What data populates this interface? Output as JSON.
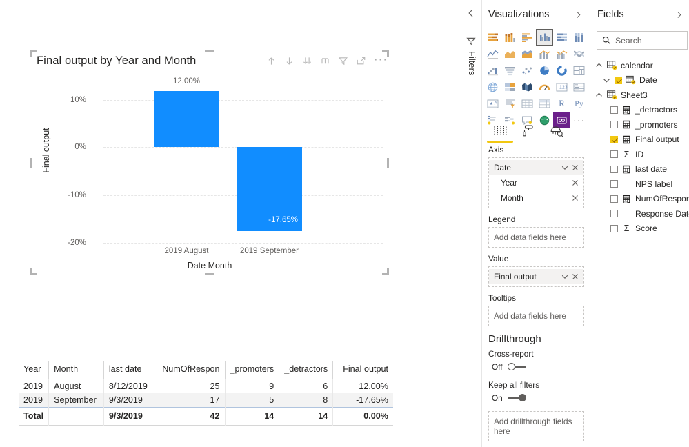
{
  "chart_data": {
    "type": "bar",
    "title": "Final output by Year and Month",
    "xlabel": "Date Month",
    "ylabel": "Final output",
    "categories": [
      "2019 August",
      "2019 September"
    ],
    "values": [
      12.0,
      -17.65
    ],
    "data_labels": [
      "12.00%",
      "-17.65%"
    ],
    "ytick_labels": [
      "10%",
      "0%",
      "-10%",
      "-20%"
    ],
    "ytick_values": [
      10,
      0,
      -10,
      -20
    ],
    "ylim": [
      -22,
      13
    ],
    "grid": true,
    "legend": "none",
    "series_color": "#118DFF"
  },
  "chart_visual": {
    "title": "Final output by Year and Month",
    "header_icons": [
      {
        "name": "drill-up-icon",
        "label": "Drill up"
      },
      {
        "name": "drill-down-icon",
        "label": "Go to the next level in the hierarchy"
      },
      {
        "name": "expand-all-icon",
        "label": "Expand all down one level in the hierarchy"
      },
      {
        "name": "drill-mode-icon",
        "label": "Drill mode"
      },
      {
        "name": "filter-icon",
        "label": "Filters"
      },
      {
        "name": "focus-mode-icon",
        "label": "Focus mode"
      },
      {
        "name": "more-options-icon",
        "label": "More options"
      }
    ]
  },
  "table_visual": {
    "columns": [
      "Year",
      "Month",
      "last date",
      "NumOfRespon",
      "_promoters",
      "_detractors",
      "Final output"
    ],
    "column_align": [
      "right",
      "left",
      "left",
      "right",
      "right",
      "right",
      "right"
    ],
    "rows": [
      [
        "2019",
        "August",
        "8/12/2019",
        "25",
        "9",
        "6",
        "12.00%"
      ],
      [
        "2019",
        "September",
        "9/3/2019",
        "17",
        "5",
        "8",
        "-17.65%"
      ]
    ],
    "total_row": [
      "Total",
      "",
      "9/3/2019",
      "42",
      "14",
      "14",
      "0.00%"
    ]
  },
  "filters_rail": {
    "label": "Filters",
    "collapse_icon": "chevron-left-icon",
    "filter_icon": "filter-icon"
  },
  "visualizations": {
    "title": "Visualizations",
    "expand_icon": "chevron-right-icon",
    "gallery": [
      {
        "name": "stacked-bar-chart",
        "selected": false
      },
      {
        "name": "stacked-column-chart",
        "selected": false
      },
      {
        "name": "clustered-bar-chart",
        "selected": false
      },
      {
        "name": "clustered-column-chart",
        "selected": true
      },
      {
        "name": "100-percent-stacked-bar-chart",
        "selected": false
      },
      {
        "name": "100-percent-stacked-column-chart",
        "selected": false
      },
      {
        "name": "line-chart",
        "selected": false
      },
      {
        "name": "area-chart",
        "selected": false
      },
      {
        "name": "stacked-area-chart",
        "selected": false
      },
      {
        "name": "line-and-stacked-column-chart",
        "selected": false
      },
      {
        "name": "line-and-clustered-column-chart",
        "selected": false
      },
      {
        "name": "ribbon-chart",
        "selected": false
      },
      {
        "name": "waterfall-chart",
        "selected": false
      },
      {
        "name": "funnel-chart",
        "selected": false
      },
      {
        "name": "scatter-chart",
        "selected": false
      },
      {
        "name": "pie-chart",
        "selected": false
      },
      {
        "name": "donut-chart",
        "selected": false
      },
      {
        "name": "treemap",
        "selected": false
      },
      {
        "name": "map",
        "selected": false
      },
      {
        "name": "filled-map",
        "selected": false
      },
      {
        "name": "shape-map",
        "selected": false
      },
      {
        "name": "gauge",
        "selected": false
      },
      {
        "name": "card",
        "selected": false
      },
      {
        "name": "multi-row-card",
        "selected": false
      },
      {
        "name": "kpi",
        "selected": false
      },
      {
        "name": "slicer",
        "selected": false
      },
      {
        "name": "table",
        "selected": false
      },
      {
        "name": "matrix",
        "selected": false
      },
      {
        "name": "r-script-visual",
        "selected": false,
        "text": "R"
      },
      {
        "name": "python-visual",
        "selected": false,
        "text": "Py"
      },
      {
        "name": "key-influencers",
        "selected": false
      },
      {
        "name": "decomposition-tree",
        "selected": false
      },
      {
        "name": "q-and-a",
        "selected": false
      },
      {
        "name": "arcgis-maps",
        "selected": false
      },
      {
        "name": "paginated-report",
        "selected": false,
        "purple": true
      },
      {
        "name": "more-visuals",
        "selected": false,
        "text": "..."
      }
    ],
    "tabs": [
      {
        "name": "fields-tab",
        "label": "Fields",
        "icon": "fields-grid-icon",
        "active": true
      },
      {
        "name": "format-tab",
        "label": "Format",
        "icon": "paint-roller-icon",
        "active": false
      },
      {
        "name": "analytics-tab",
        "label": "Analytics",
        "icon": "analytics-magnifier-icon",
        "active": false
      }
    ],
    "wells": {
      "axis": {
        "label": "Axis",
        "chips": [
          {
            "name": "Date",
            "sub": false,
            "has_chevron": true
          },
          {
            "name": "Year",
            "sub": true,
            "has_chevron": false
          },
          {
            "name": "Month",
            "sub": true,
            "has_chevron": false
          }
        ]
      },
      "legend": {
        "label": "Legend",
        "placeholder": "Add data fields here",
        "chips": []
      },
      "value": {
        "label": "Value",
        "chips": [
          {
            "name": "Final output",
            "sub": false,
            "has_chevron": true
          }
        ]
      },
      "tooltips": {
        "label": "Tooltips",
        "placeholder": "Add data fields here",
        "chips": []
      }
    },
    "drillthrough": {
      "title": "Drillthrough",
      "cross_report": {
        "label": "Cross-report",
        "state": "Off",
        "on": false
      },
      "keep_all_filters": {
        "label": "Keep all filters",
        "state": "On",
        "on": true
      },
      "placeholder": "Add drillthrough fields here"
    }
  },
  "fields": {
    "title": "Fields",
    "expand_icon": "chevron-right-icon",
    "search": {
      "placeholder": "Search",
      "value": "",
      "icon": "search-icon"
    },
    "tree": [
      {
        "label": "calendar",
        "type": "table",
        "indent": 0,
        "expanded": true,
        "checkbox": false,
        "icon": "table-icon"
      },
      {
        "label": "Date",
        "type": "hierarchy",
        "indent": 1,
        "expanded": true,
        "checkbox": true,
        "checked": true,
        "icon": "date-hierarchy-icon"
      },
      {
        "label": "Sheet3",
        "type": "table",
        "indent": 0,
        "expanded": true,
        "checkbox": false,
        "icon": "table-icon"
      },
      {
        "label": "_detractors",
        "type": "measure",
        "indent": 2,
        "checkbox": true,
        "checked": false,
        "icon": "measure-icon"
      },
      {
        "label": "_promoters",
        "type": "measure",
        "indent": 2,
        "checkbox": true,
        "checked": false,
        "icon": "measure-icon"
      },
      {
        "label": "Final output",
        "type": "measure",
        "indent": 2,
        "checkbox": true,
        "checked": true,
        "icon": "measure-icon"
      },
      {
        "label": "ID",
        "type": "sum",
        "indent": 2,
        "checkbox": true,
        "checked": false,
        "icon": "sigma-icon"
      },
      {
        "label": "last date",
        "type": "measure",
        "indent": 2,
        "checkbox": true,
        "checked": false,
        "icon": "measure-icon"
      },
      {
        "label": "NPS label",
        "type": "column",
        "indent": 2,
        "checkbox": true,
        "checked": false,
        "icon": "none"
      },
      {
        "label": "NumOfRespon",
        "type": "measure",
        "indent": 2,
        "checkbox": true,
        "checked": false,
        "icon": "measure-icon"
      },
      {
        "label": "Response Date",
        "type": "column",
        "indent": 2,
        "checkbox": true,
        "checked": false,
        "icon": "none"
      },
      {
        "label": "Score",
        "type": "sum",
        "indent": 2,
        "checkbox": true,
        "checked": false,
        "icon": "sigma-icon"
      }
    ]
  },
  "colors": {
    "accent_blue": "#118DFF",
    "brand_yellow": "#F2C811",
    "text": "#252423",
    "muted_text": "#605e5c",
    "border": "#e6e6e6"
  }
}
